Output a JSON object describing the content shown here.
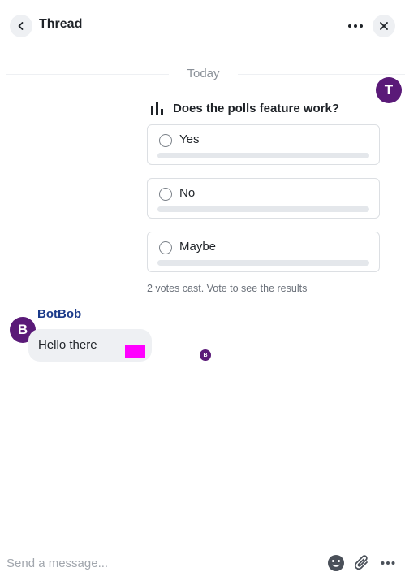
{
  "header": {
    "title": "Thread",
    "back_icon": "chevron-left-icon",
    "more_icon": "more-horizontal-icon",
    "close_icon": "close-icon"
  },
  "date_separator": "Today",
  "poll": {
    "author_initial": "T",
    "question_icon": "bar-chart-icon",
    "question": "Does the polls feature work?",
    "options": [
      {
        "label": "Yes",
        "fill_fraction": 0
      },
      {
        "label": "No",
        "fill_fraction": 0
      },
      {
        "label": "Maybe",
        "fill_fraction": 0
      }
    ],
    "status": "2 votes cast. Vote to see the results"
  },
  "message": {
    "author_initial": "B",
    "sender": "BotBob",
    "text": "Hello there",
    "read_receipt_initial": "B"
  },
  "composer": {
    "placeholder": "Send a message...",
    "emoji_icon": "emoji-icon",
    "attach_icon": "paperclip-icon",
    "more_icon": "more-horizontal-icon"
  },
  "colors": {
    "accent": "#5a1a78",
    "sender_name": "#1b3a8a",
    "bubble_bg": "#eef0f3",
    "highlight_marker": "#ff00ff"
  }
}
